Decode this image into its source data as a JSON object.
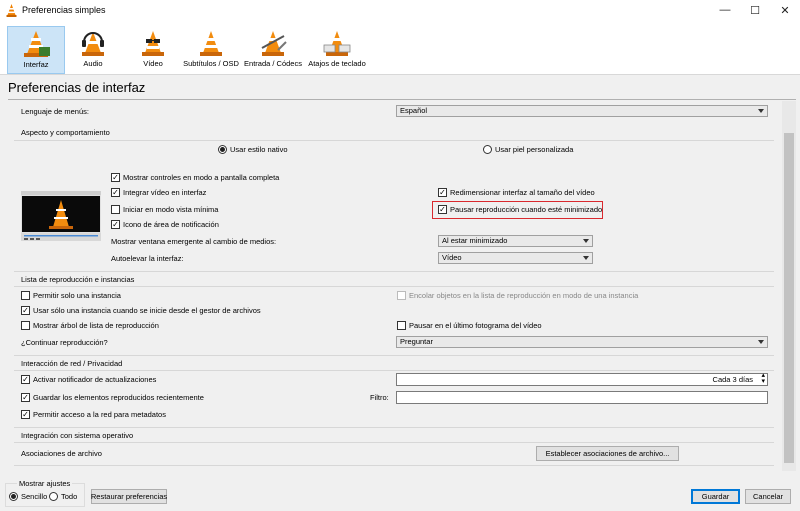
{
  "window": {
    "title": "Preferencias simples",
    "minimize": "—",
    "maximize": "☐",
    "close": "✕"
  },
  "toolbar": {
    "items": [
      {
        "label": "Interfaz",
        "icon": "cone-interface-icon",
        "selected": true
      },
      {
        "label": "Audio",
        "icon": "cone-headphones-icon",
        "selected": false
      },
      {
        "label": "Vídeo",
        "icon": "cone-glasses-icon",
        "selected": false
      },
      {
        "label": "Subtítulos / OSD",
        "icon": "cone-subtitles-icon",
        "selected": false
      },
      {
        "label": "Entrada / Códecs",
        "icon": "cone-input-icon",
        "selected": false
      },
      {
        "label": "Atajos de teclado",
        "icon": "cone-hotkeys-icon",
        "selected": false
      }
    ]
  },
  "page_title": "Preferencias de interfaz",
  "language": {
    "label": "Lenguaje de menús:",
    "value": "Español"
  },
  "look": {
    "group_title": "Aspecto y comportamiento",
    "radio_native": "Usar estilo nativo",
    "radio_custom": "Usar piel personalizada",
    "native_selected": true,
    "checkboxes": {
      "fullscreen_controls": {
        "label": "Mostrar controles en modo a pantalla completa",
        "checked": true
      },
      "embed_video": {
        "label": "Integrar vídeo en interfaz",
        "checked": true
      },
      "minimal_mode": {
        "label": "Iniciar en modo vista mínima",
        "checked": false
      },
      "systray": {
        "label": "Icono de área de notificación",
        "checked": true
      },
      "resize_interface": {
        "label": "Redimensionar interfaz al tamaño del vídeo",
        "checked": true
      },
      "pause_minimized": {
        "label": "Pausar reproducción cuando esté minimizado",
        "checked": true
      }
    },
    "popup_label": "Mostrar ventana emergente al cambio de medios:",
    "popup_value": "Al estar minimizado",
    "raise_label": "Autoelevar la interfaz:",
    "raise_value": "Vídeo",
    "highlight_color": "#d9292e"
  },
  "playlist": {
    "group_title": "Lista de reproducción e instancias",
    "one_instance": {
      "label": "Permitir solo una instancia",
      "checked": false
    },
    "enqueue": {
      "label": "Encolar objetos en la lista de reproducción en modo de una instancia",
      "checked": false,
      "disabled": true
    },
    "file_manager": {
      "label": "Usar sólo una instancia cuando se inicie desde el gestor de archivos",
      "checked": true
    },
    "tree": {
      "label": "Mostrar árbol de lista de reproducción",
      "checked": false
    },
    "pause_last_frame": {
      "label": "Pausar en el último fotograma del vídeo",
      "checked": false
    },
    "continue_label": "¿Continuar reproducción?",
    "continue_value": "Preguntar"
  },
  "network": {
    "group_title": "Interacción de red / Privacidad",
    "update_notifier": {
      "label": "Activar notificador de actualizaciones",
      "checked": true
    },
    "update_interval": "Cada 3 días",
    "recent_items": {
      "label": "Guardar los elementos reproducidos recientemente",
      "checked": true
    },
    "filter_label": "Filtro:",
    "filter_value": "",
    "metadata": {
      "label": "Permitir acceso a la red para metadatos",
      "checked": true
    }
  },
  "os": {
    "group_title": "Integración con sistema operativo",
    "assoc_label": "Asociaciones de archivo",
    "assoc_button": "Establecer asociaciones de archivo..."
  },
  "footer": {
    "show_settings": "Mostrar ajustes",
    "simple": "Sencillo",
    "all": "Todo",
    "simple_selected": true,
    "reset": "Restaurar preferencias",
    "save": "Guardar",
    "cancel": "Cancelar"
  }
}
